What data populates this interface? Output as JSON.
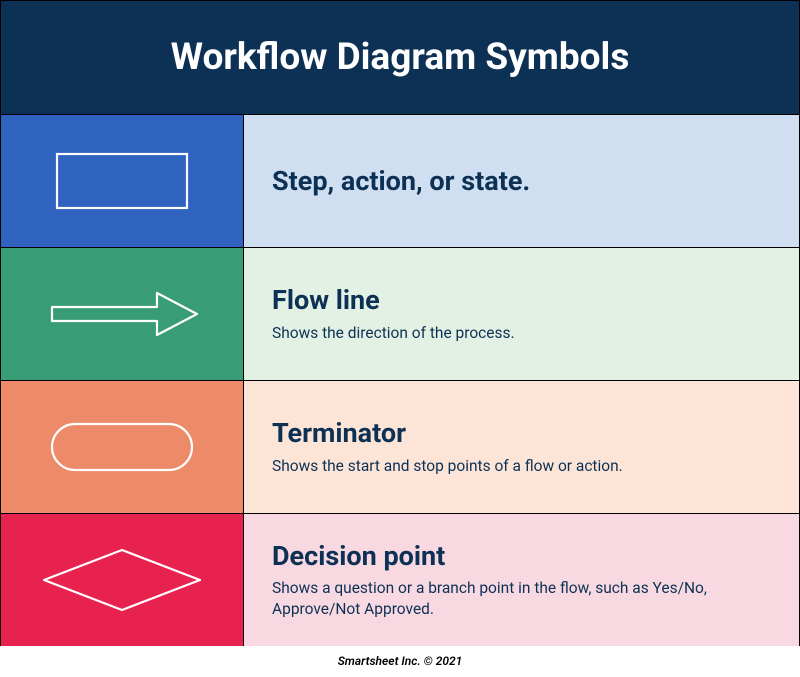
{
  "header": {
    "title": "Workflow Diagram Symbols"
  },
  "rows": [
    {
      "symbol": "rectangle",
      "title": "Step, action, or state.",
      "subtitle": ""
    },
    {
      "symbol": "arrow",
      "title": "Flow line",
      "subtitle": "Shows the direction of the process."
    },
    {
      "symbol": "rounded-rect",
      "title": "Terminator",
      "subtitle": "Shows the start and stop points of a flow or action."
    },
    {
      "symbol": "diamond",
      "title": "Decision point",
      "subtitle": "Shows a question or a branch point in the flow, such as Yes/No, Approve/Not Approved."
    }
  ],
  "footer": {
    "text": "Smartsheet Inc. © 2021"
  }
}
